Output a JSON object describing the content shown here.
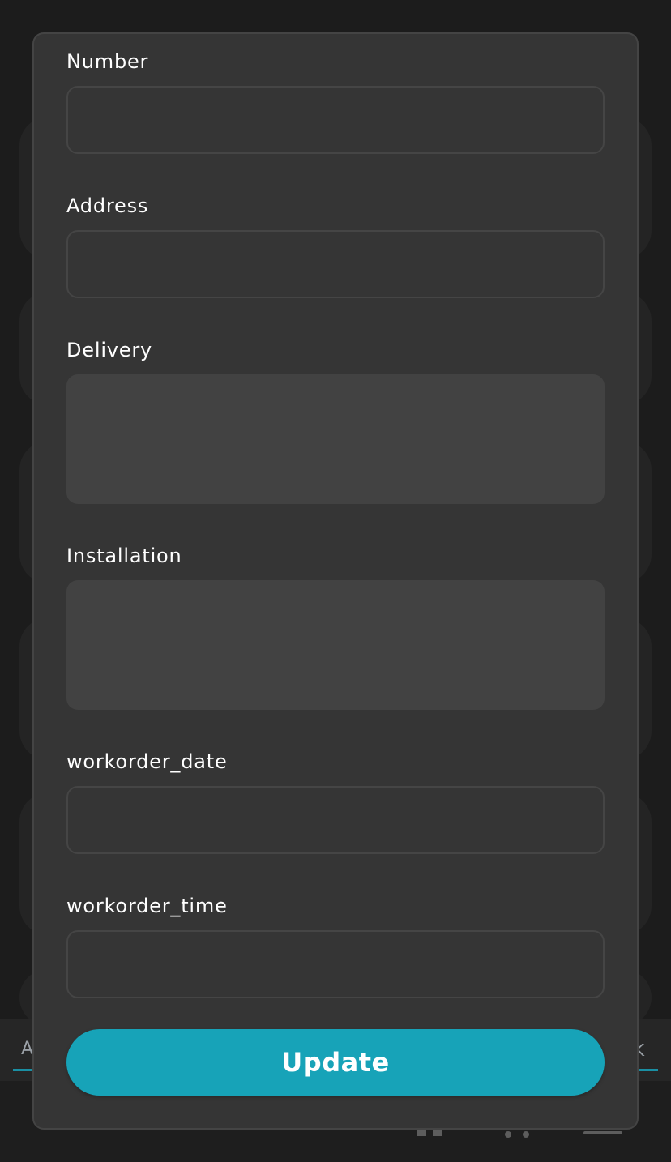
{
  "background": {
    "tab_left_label": "A",
    "tab_right_label": "K"
  },
  "form": {
    "fields": [
      {
        "label": "Number",
        "value": "",
        "placeholder": ""
      },
      {
        "label": "Address",
        "value": "",
        "placeholder": ""
      },
      {
        "label": "Delivery",
        "value": "",
        "placeholder": ""
      },
      {
        "label": "Installation",
        "value": "",
        "placeholder": ""
      },
      {
        "label": "workorder_date",
        "value": "",
        "placeholder": ""
      },
      {
        "label": "workorder_time",
        "value": "",
        "placeholder": ""
      }
    ],
    "submit_label": "Update"
  },
  "colors": {
    "accent": "#17a3b8",
    "modal_bg": "#353535",
    "page_bg": "#1c1c1c"
  }
}
